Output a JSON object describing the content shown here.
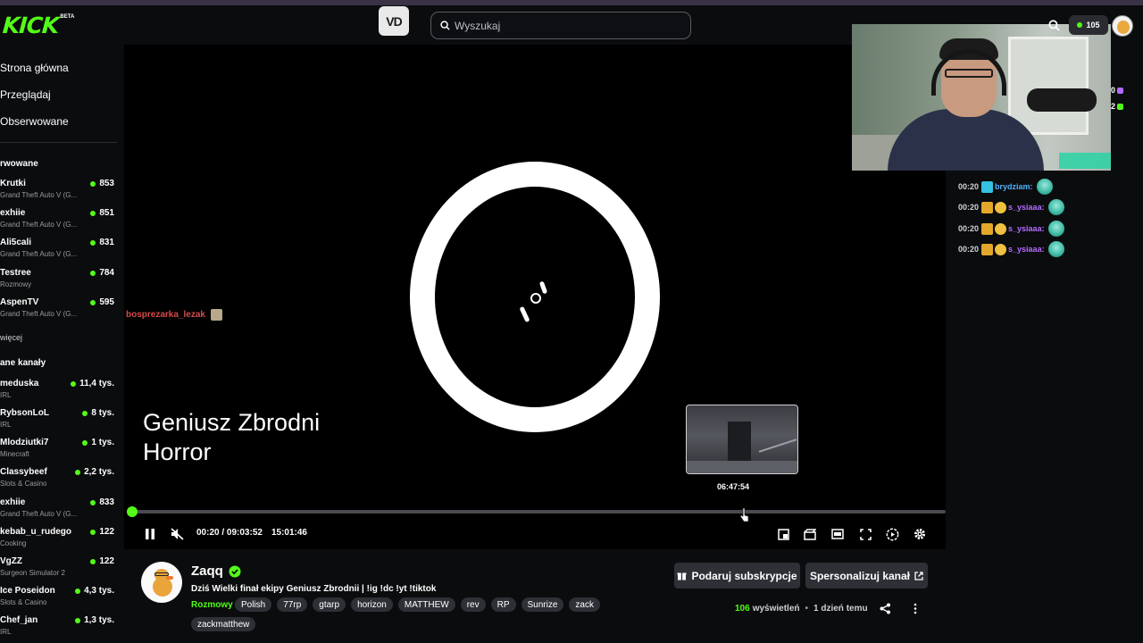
{
  "header": {
    "logo": "KICK",
    "logo_badge": "BETA",
    "vod_button": "VD",
    "search_placeholder": "Wyszukaj",
    "badge_value": "105"
  },
  "sidebar": {
    "nav": [
      "Strona główna",
      "Przeglądaj",
      "Obserwowane"
    ],
    "section_followed": "rwowane",
    "followed": [
      {
        "name": "Krutki",
        "category": "Grand Theft Auto V (G...",
        "viewers": "853"
      },
      {
        "name": "exhiie",
        "category": "Grand Theft Auto V (G...",
        "viewers": "851"
      },
      {
        "name": "Ali5cali",
        "category": "Grand Theft Auto V (G...",
        "viewers": "831"
      },
      {
        "name": "Testree",
        "category": "Rozmowy",
        "viewers": "784"
      },
      {
        "name": "AspenTV",
        "category": "Grand Theft Auto V (G...",
        "viewers": "595"
      }
    ],
    "more_label": "więcej",
    "section_recommended": "ane kanały",
    "recommended": [
      {
        "name": "meduska",
        "category": "IRL",
        "viewers": "11,4 tys."
      },
      {
        "name": "RybsonLoL",
        "category": "IRL",
        "viewers": "8 tys."
      },
      {
        "name": "Mlodziutki7",
        "category": "Minecraft",
        "viewers": "1 tys."
      },
      {
        "name": "Classybeef",
        "category": "Slots & Casino",
        "viewers": "2,2 tys."
      },
      {
        "name": "exhiie",
        "category": "Grand Theft Auto V (G...",
        "viewers": "833"
      },
      {
        "name": "kebab_u_rudego",
        "category": "Cooking",
        "viewers": "122"
      },
      {
        "name": "VgZZ",
        "category": "Surgeon Simulator 2",
        "viewers": "122"
      },
      {
        "name": "Ice Poseidon",
        "category": "Slots & Casino",
        "viewers": "4,3 tys."
      },
      {
        "name": "Chef_jan",
        "category": "IRL",
        "viewers": "1,3 tys."
      }
    ]
  },
  "player": {
    "overlay_user": "bosprezarka_lezak",
    "title_line1": "Geniusz Zbrodni",
    "title_line2": "Horror",
    "preview_time": "06:47:54",
    "progress": 0.0011,
    "hover_position": 0.75,
    "time_display": "00:20 / 09:03:52",
    "clock": "15:01:46"
  },
  "chat_side_counts": [
    "0",
    "2"
  ],
  "chat": [
    {
      "time": "00:20",
      "user": "brydziam:",
      "user_color": "#4fb2ff",
      "badge_color": "#35c1e0"
    },
    {
      "time": "00:20",
      "user": "s_ysiaaa:",
      "user_color": "#b46bff",
      "badge_color": "#e3a82a"
    },
    {
      "time": "00:20",
      "user": "s_ysiaaa:",
      "user_color": "#b46bff",
      "badge_color": "#e3a82a"
    },
    {
      "time": "00:20",
      "user": "s_ysiaaa:",
      "user_color": "#b46bff",
      "badge_color": "#e3a82a"
    }
  ],
  "stream": {
    "name": "Zaqq",
    "title": "Dziś Wielki finał ekipy Geniusz Zbrodnii | !ig !dc !yt !tiktok",
    "category": "Rozmowy",
    "tags": [
      "Polish",
      "77rp",
      "gtarp",
      "horizon",
      "MATTHEW",
      "rev",
      "RP",
      "Sunrize",
      "zack"
    ],
    "tag_row2": "zackmatthew",
    "gift_button": "Podaruj subskrypcje",
    "customize_button": "Spersonalizuj kanał",
    "views_count": "106",
    "views_label": "wyświetleń",
    "time_ago": "1 dzień temu"
  },
  "colors": {
    "brand": "#53fc18",
    "background": "#0b0c0e",
    "button_bg": "#2e3036"
  }
}
